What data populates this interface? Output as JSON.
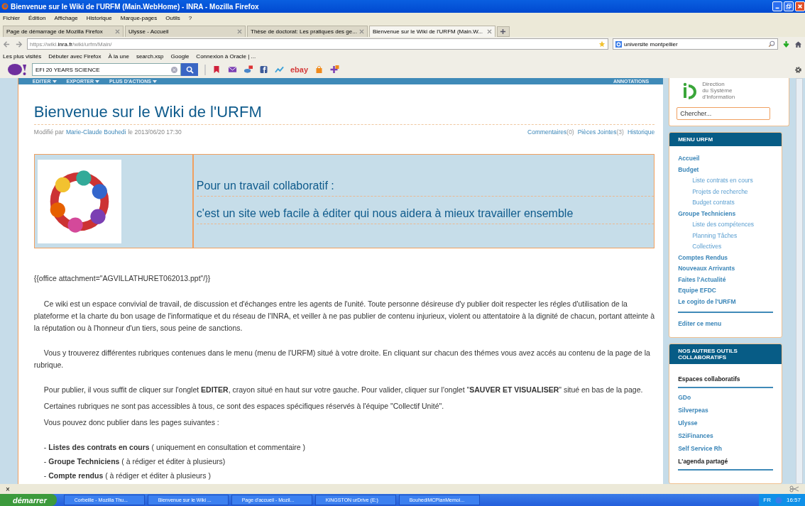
{
  "window": {
    "title": "Bienvenue sur le Wiki de l'URFM (Main.WebHome) - INRA - Mozilla Firefox"
  },
  "menu_bar": [
    "Fichier",
    "Édition",
    "Affichage",
    "Historique",
    "Marque-pages",
    "Outils",
    "?"
  ],
  "tabs": [
    {
      "label": "Page de démarrage de Mozilla Firefox",
      "selected": false
    },
    {
      "label": "Ulysse - Accueil",
      "selected": false
    },
    {
      "label": "Thèse de doctorat: Les pratiques des ge...",
      "selected": false
    },
    {
      "label": "Bienvenue sur le Wiki de l'URFM (Main.W...",
      "selected": true
    }
  ],
  "address": {
    "prefix": "https://wiki.",
    "domain": "inra.fr",
    "path": "/wiki/urfm/Main/"
  },
  "search": {
    "value": "universite montpellier"
  },
  "bookmarks": [
    "Les plus visités",
    "Débuter avec Firefox",
    "À la une",
    "search.xsp",
    "Google",
    "Connexion à Oracle | ..."
  ],
  "yahoo_bar": {
    "search_value": "EFI 20 YEARS SCIENCE",
    "ebay": "ebay"
  },
  "wiki": {
    "actions": [
      "EDITER",
      "EXPORTER",
      "PLUS D'ACTIONS"
    ],
    "annotations": "ANNOTATIONS",
    "title": "Bienvenue sur le Wiki de l'URFM",
    "meta": {
      "prefix": "Modifié par",
      "author": "Marie-Claude Bouhedi",
      "date": "le 2013/06/20 17:30"
    },
    "meta_links": [
      {
        "label": "Commentaires",
        "count": "(0)"
      },
      {
        "label": "Pièces Jointes",
        "count": "(3)"
      },
      {
        "label": "Historique"
      }
    ],
    "banner": [
      "Pour un travail collaboratif :",
      "c'est un site web facile à éditer qui nous aidera à mieux travailler ensemble"
    ],
    "attachment": "{{office attachment=\"AGVILLATHURET062013.ppt\"/}}",
    "paragraph_blocks": [
      [
        "Ce wiki est un espace convivial de travail, de discussion et d'échanges entre les agents de l'unité. Toute personne désireuse d'y publier doit respecter les régles d'utilisation de la plateforme et la charte du bon usage de l'informatique et du réseau de l'INRA, et veiller à ne pas publier de contenu injurieux, violent ou attentatoire à la dignité de chacun, portant atteinte à la réputation ou à l'honneur d'un tiers, sous peine de sanctions."
      ],
      [
        "Vous y trouverez différentes rubriques contenues dans le menu (menu de l'URFM) situé à votre droite. En cliquant sur chacun des thémes vous avez accés au contenu de la page de la rubrique."
      ],
      [
        "Pour publier, il vous suffit de cliquer sur  l'onglet **EDITER**, crayon situé en haut sur votre gauche. Pour valider, cliquer sur l'onglet  \"**SAUVER ET VISUALISER**\" situé en bas de la page.",
        "Certaines rubriques ne sont pas accessibles à tous, ce sont des espaces spécifiques réservés à l'équipe \"Collectif Unité\".",
        "Vous pouvez donc publier dans les pages suivantes :"
      ]
    ],
    "list": [
      "- **Listes des contrats en cours** ( uniquement en consultation et commentaire )",
      "- **Groupe Techniciens** ( à rédiger et éditer à plusieurs)",
      "- **Compte rendus** ( à rédiger et éditer à plusieurs )"
    ]
  },
  "sidebar": {
    "logo_lines": [
      "Direction",
      "du Système",
      "d'Information"
    ],
    "search_placeholder": "Chercher...",
    "menu_title": "MENU URFM",
    "menu": [
      {
        "label": "Accueil"
      },
      {
        "label": "Budget",
        "children": [
          {
            "label": "Liste contrats en cours"
          },
          {
            "label": "Projets de recherche"
          },
          {
            "label": "Budget contrats"
          }
        ]
      },
      {
        "label": "Groupe Techniciens",
        "children": [
          {
            "label": "Liste des compétences"
          },
          {
            "label": "Planning Tâches"
          },
          {
            "label": "Collectives"
          }
        ]
      },
      {
        "label": "Comptes Rendus"
      },
      {
        "label": "Nouveaux Arrivants"
      },
      {
        "label": "Faites l'Actualité"
      },
      {
        "label": "Equipe EFDC"
      },
      {
        "label": "Le cogito de l'URFM"
      }
    ],
    "edit_menu": "Editer ce menu",
    "tools_title": "NOS AUTRES OUTILS COLLABORATIFS",
    "tools": [
      {
        "label": "Espaces collaboratifs",
        "kind": "heading"
      },
      {
        "label": "GDo",
        "kind": "link"
      },
      {
        "label": "Silverpeas",
        "kind": "link"
      },
      {
        "label": "Ulysse",
        "kind": "link"
      },
      {
        "label": "S2iFinances",
        "kind": "link"
      },
      {
        "label": "Self Service Rh",
        "kind": "link"
      },
      {
        "label": "L'agenda partagé",
        "kind": "heading"
      }
    ]
  },
  "find_bar": {
    "close": "×"
  },
  "taskbar": {
    "start": "démarrer",
    "items": [
      "Corbeille - Mozilla Thu...",
      "Bienvenue sur le Wiki ...",
      "Page d'accueil - Mozil...",
      "KINGSTON urDrive (E:)",
      "BouhediMCPlanMemoi..."
    ],
    "language": "FR",
    "time": "16:57"
  }
}
